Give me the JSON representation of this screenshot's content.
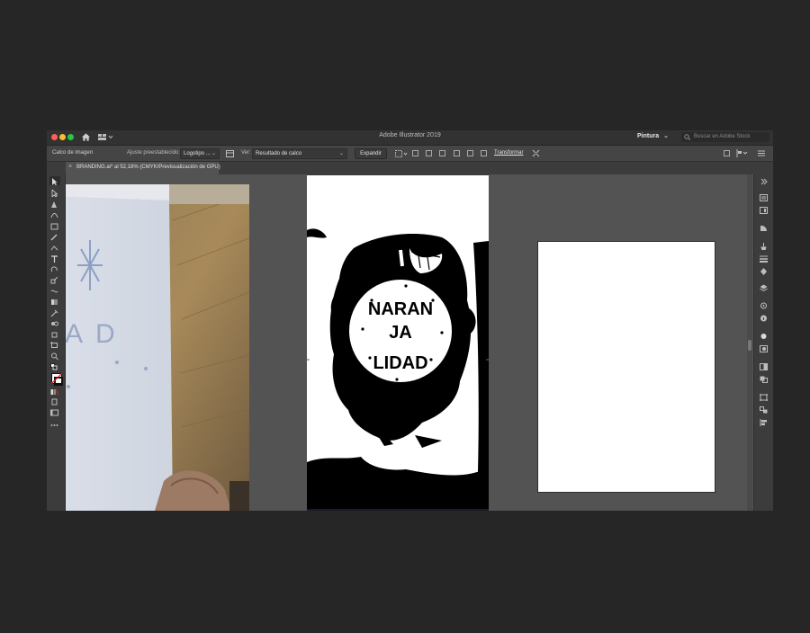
{
  "window": {
    "title": "Adobe Illustrator 2019"
  },
  "titlebar": {
    "workspace": "Pintura",
    "workspace_arrow": "⌄",
    "stock_search_placeholder": "Buscar en Adobe Stock"
  },
  "control_bar": {
    "panel_label": "Calco de imagen",
    "preset_label": "Ajuste preestablecido:",
    "preset_value": "Logotipo ...",
    "view_label": "Ver:",
    "view_value": "Resultado de calco",
    "expand_button": "Expandir",
    "transform_link": "Transformar"
  },
  "document_tab": {
    "label": "BRANDING.ai* al 52,18% (CMYK/Previsualización de GPU)",
    "close": "×"
  },
  "artwork": {
    "line1": "NARAN",
    "line2": "JA",
    "line3": "LIDAD"
  },
  "photo_sketch_letters": [
    "A",
    "D"
  ],
  "colors": {
    "ui_dark": "#323232",
    "panel": "#3c3c3c",
    "canvas": "#535353",
    "accent_fill": "#ffffff",
    "stroke_red": "#e0201a"
  }
}
